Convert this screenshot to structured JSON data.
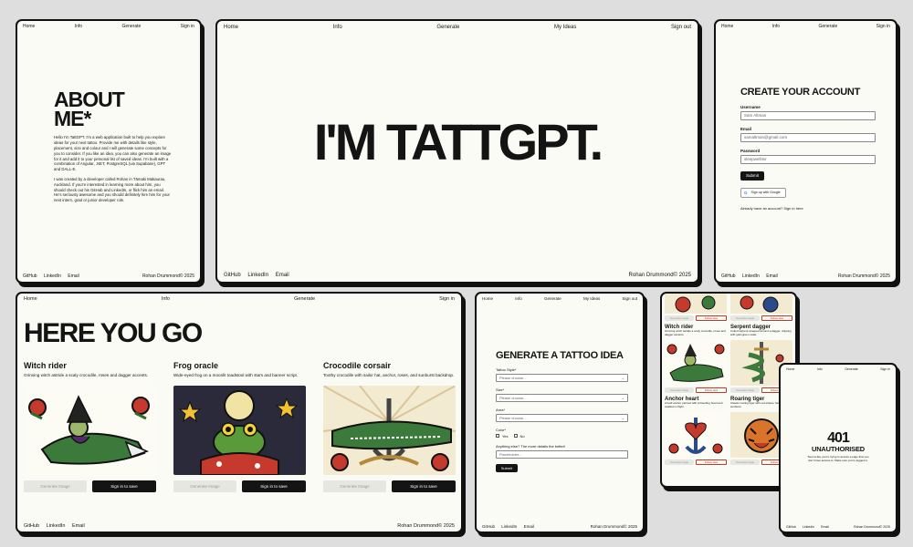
{
  "nav4": {
    "home": "Home",
    "info": "Info",
    "generate": "Generate",
    "signin": "Sign in"
  },
  "nav5": {
    "home": "Home",
    "info": "Info",
    "generate": "Generate",
    "ideas": "My Ideas",
    "signout": "Sign out"
  },
  "footer": {
    "github": "GitHub",
    "linkedin": "LinkedIn",
    "email": "Email",
    "credit": "Rohan Drummond© 2025"
  },
  "about": {
    "title_line1": "ABOUT",
    "title_line2": "ME*",
    "para1": "Hello I'm TattGPT. I'm a web application built to help you explore ideas for your next tattoo. Provide me with details like style, placement, size and colour and I will generate some concepts for you to consider. If you like an idea, you can also generate an image for it and add it to your personal list of saved ideas. I'm built with a combination of Angular, .NET, PostgreSQL (via Supabase), GPT and DALL-E.",
    "para2": "I was created by a developer called Rohan in Tāmaki Makaurau, Auckland. If you're interested in learning more about him, you should check out his GitHub and LinkedIn, or flick him an email. He's seriously awesome and you should definitely hire him for your next intern, grad or junior developer role."
  },
  "hero": {
    "title": "I'M TATTGPT."
  },
  "signup": {
    "title": "CREATE YOUR ACCOUNT",
    "username_label": "Username",
    "username_value": "Sam Altman",
    "email_label": "Email",
    "email_value": "samaltman@gmail.com",
    "password_label": "Password",
    "password_value": "sleepwell4vr",
    "submit": "Submit",
    "google": "Sign up with Google",
    "signin_prompt": "Already have an account? Sign in here"
  },
  "results": {
    "title": "HERE YOU GO",
    "cards": [
      {
        "name": "Witch rider",
        "desc": "Grinning witch astride a scaly crocodile, roses and dagger accents.",
        "gen": "Generate Image",
        "save": "Sign in to save"
      },
      {
        "name": "Frog oracle",
        "desc": "Wide-eyed frog on a moonlit toadstool with stars and banner script.",
        "gen": "Generate Image",
        "save": "Sign in to save"
      },
      {
        "name": "Crocodile corsair",
        "desc": "Toothy crocodile with sailor hat, anchor, roses, and sunburst backdrop.",
        "gen": "Generate Image",
        "save": "Sign in to save"
      }
    ]
  },
  "generate": {
    "title": "GENERATE A TATTOO IDEA",
    "style_label": "Tattoo Style*",
    "size_label": "Size*",
    "area_label": "Area*",
    "colour_label": "Color*",
    "placeholder": "Please choose...",
    "yes": "Yes",
    "no": "No",
    "details_label": "Anything else? The more details the better!",
    "details_placeholder": "Placeholder...",
    "submit": "Submit"
  },
  "ideas": {
    "items": [
      {
        "name": "Witch rider",
        "desc": "Grinning witch astride a scaly crocodile, roses and dagger accents.",
        "gen": "Generate Image",
        "del": "Delete idea"
      },
      {
        "name": "Serpent dagger",
        "desc": "Coiled serpent wrapped around a dagger, dripping with gold-green scale.",
        "gen": "Generate Image",
        "del": "Delete idea"
      },
      {
        "name": "Anchor heart",
        "desc": "A bold anchor pierced with a bleeding heart and swallow in flight.",
        "gen": "Generate Image",
        "del": "Delete idea"
      },
      {
        "name": "Roaring tiger",
        "desc": "Classic roaring tiger with red stripes, fangs, and sunburst.",
        "gen": "Generate Image",
        "del": "Delete idea"
      }
    ],
    "top_gen": "Generate Image",
    "top_del": "Delete idea"
  },
  "error": {
    "code": "401",
    "title": "UNAUTHORISED",
    "message": "Seems like you're trying to access a page that you don't have access to. Make sure you're logged in."
  },
  "colors": {
    "bg": "#dedede",
    "card": "#fbfbf6",
    "ink": "#141414",
    "accent": "#c0392b"
  }
}
